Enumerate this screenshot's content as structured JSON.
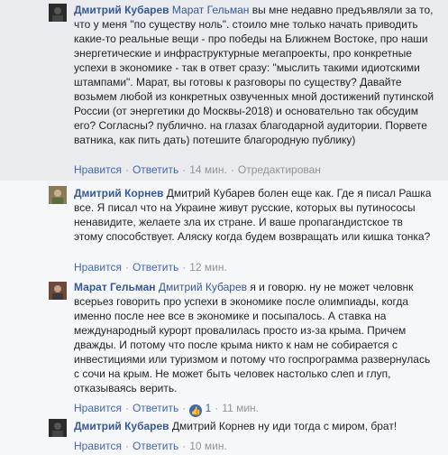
{
  "comments": [
    {
      "author": "Дмитрий Кубарев",
      "mention": "Марат Гельман",
      "text": " вы мне недавно предъявляли за то, что у меня \"по существу ноль\". стоило мне только начать приводить какие-то реальные вещи - про победы на Ближнем Востоке, про наши энергетические и инфраструктурные мегапроекты, про конкретные успехи в экономике - так в ответ сразу: \"мыслить такими идиотскими штампами\". Марат, вы готовы к разговоры по существу? Давайте возьмем любой из конкретных озвученных мной достижений путинской России (от энергетики до Москвы-2018) и основательно так обсудим его? Согласны? публично. на глазах благодарной аудитории. Порвете ватника, как пить дать) потешите благородную публику)",
      "like": "Нравится",
      "reply": "Ответить",
      "time": "14 мин.",
      "extra": "Отредактирован"
    },
    {
      "author": "Дмитрий Корнев",
      "mention": "",
      "text": " Дмитрий Кубарев болен еще как. Где я писал Рашка все. Я писал что на Украине живут русские, которых вы путинососы ненавидите, желаете зла их стране. И ваше пропагандистское тв этому способствует. Аляску когда будем возвращать или кишка тонка?",
      "like": "Нравится",
      "reply": "Ответить",
      "time": "12 мин."
    },
    {
      "author": "Марат Гельман",
      "mention": "Дмитрий Кубарев",
      "text": " я и говорю. ну не может человнк всерьез говорить про успехи в экономике после олимпиады, когда именно после нее все в экономике и посыпалось. А ставка на международный курорт провалилась просто из-за крыма. Причем дважды. И потому что после крыма никто к нам не собирается с инвестициями или туризмом и потому что госпрограмма развернулась с сочи на крым. Не может быть человек настолько слеп и глуп, отказываясь верить.",
      "like": "Нравится",
      "reply": "Ответить",
      "likes_count": "1",
      "time": "11 мин."
    },
    {
      "author": "Дмитрий Кубарев",
      "mention": "",
      "text": " Дмитрий Корнев ну иди тогда с миром, брат!",
      "like": "Нравится",
      "reply": "Ответить",
      "time": "10 мин."
    }
  ]
}
